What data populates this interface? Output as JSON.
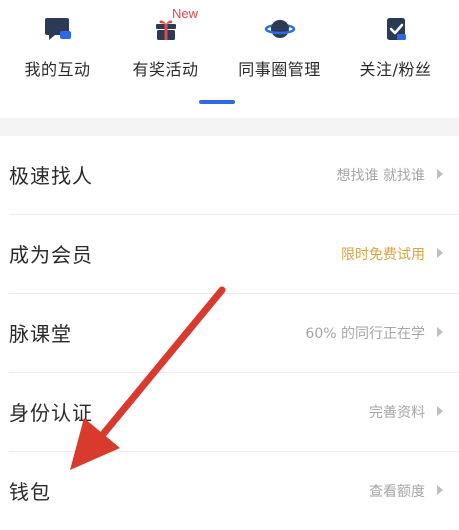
{
  "top_nav": {
    "items": [
      {
        "label": "我的互动",
        "icon": "comment-icon"
      },
      {
        "label": "有奖活动",
        "icon": "gift-icon"
      },
      {
        "label": "同事圈管理",
        "icon": "planet-icon"
      },
      {
        "label": "关注/粉丝",
        "icon": "checkbox-icon"
      }
    ],
    "new_badge": "New"
  },
  "list": {
    "rows": [
      {
        "label": "极速找人",
        "hint": "想找谁 就找谁"
      },
      {
        "label": "成为会员",
        "hint": "限时免费试用"
      },
      {
        "label": "脉课堂",
        "hint": "60% 的同行正在学"
      },
      {
        "label": "身份认证",
        "hint": "完善资料"
      },
      {
        "label": "钱包",
        "hint": "查看额度"
      }
    ]
  },
  "colors": {
    "icon": "#2d3a55",
    "accent": "#2e6ae6",
    "gold": "#d9a441",
    "badge": "#e24a4a",
    "arrow": "#d83a2e"
  }
}
